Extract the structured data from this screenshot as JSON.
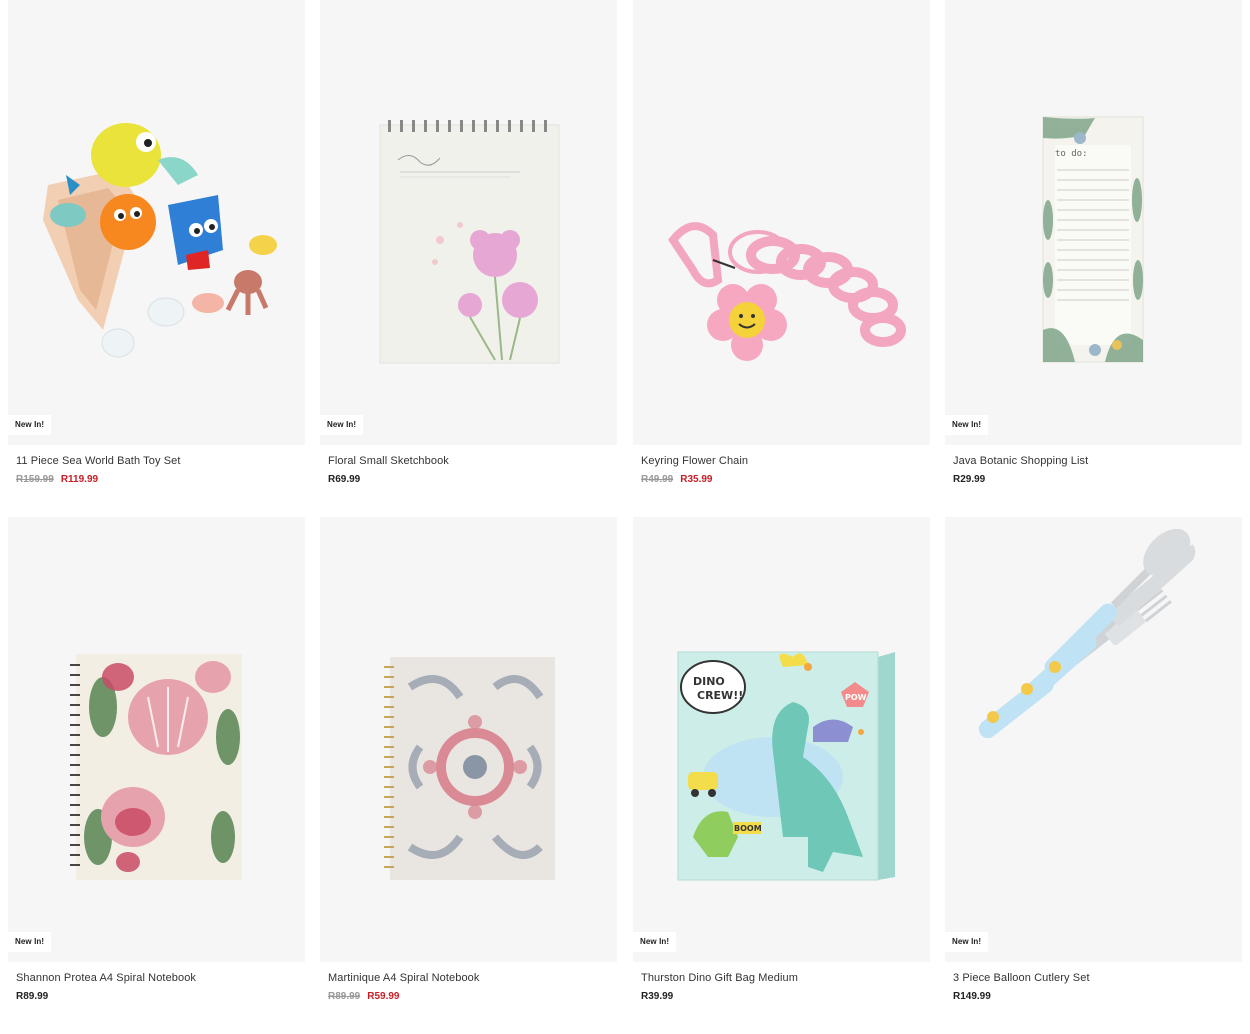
{
  "products": [
    {
      "name": "11 Piece Sea World Bath Toy Set",
      "badge": "New In!",
      "was_price": "R159.99",
      "price": "R119.99",
      "image": "bath-toy-set-image"
    },
    {
      "name": "Floral Small Sketchbook",
      "badge": "New In!",
      "was_price": "",
      "price": "R69.99",
      "image": "sketchbook-image"
    },
    {
      "name": "Keyring Flower Chain",
      "badge": "",
      "was_price": "R49.99",
      "price": "R35.99",
      "image": "keyring-image"
    },
    {
      "name": "Java Botanic Shopping List",
      "badge": "New In!",
      "was_price": "",
      "price": "R29.99",
      "image": "shopping-list-image"
    },
    {
      "name": "Shannon Protea A4 Spiral Notebook",
      "badge": "New In!",
      "was_price": "",
      "price": "R89.99",
      "image": "protea-notebook-image"
    },
    {
      "name": "Martinique A4 Spiral Notebook",
      "badge": "",
      "was_price": "R89.99",
      "price": "R59.99",
      "image": "martinique-notebook-image"
    },
    {
      "name": "Thurston Dino Gift Bag Medium",
      "badge": "New In!",
      "was_price": "",
      "price": "R39.99",
      "image": "dino-gift-bag-image"
    },
    {
      "name": "3 Piece Balloon Cutlery Set",
      "badge": "New In!",
      "was_price": "",
      "price": "R149.99",
      "image": "cutlery-set-image"
    }
  ],
  "dino_bag_text": {
    "line1": "DINO",
    "line2": "CREW!!",
    "pow": "POW",
    "boom": "BOOM"
  },
  "shopping_list_text": "to do:",
  "colors": {
    "sale": "#c81d25",
    "card_bg": "#f6f6f6",
    "was": "#999999"
  }
}
